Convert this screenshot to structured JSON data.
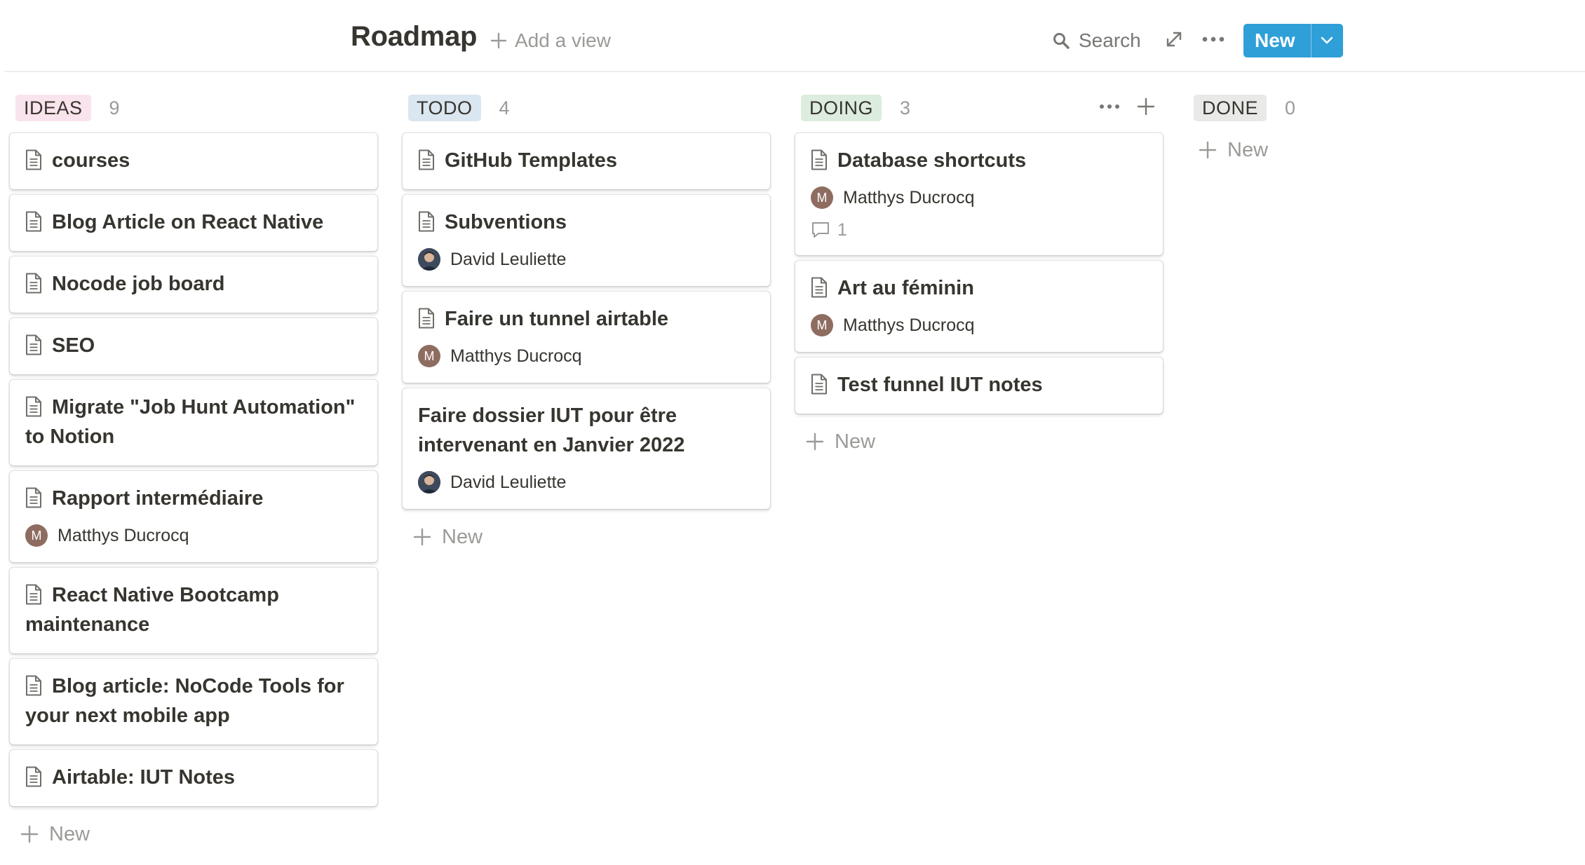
{
  "header": {
    "title": "Roadmap",
    "add_view": "Add a view",
    "search": "Search",
    "new_button": "New"
  },
  "columns": [
    {
      "tag": "IDEAS",
      "count": "9",
      "tag_color": "#f9e3ec",
      "new_label": "New",
      "cards": [
        {
          "title": "courses"
        },
        {
          "title": "Blog Article on React Native"
        },
        {
          "title": "Nocode job board"
        },
        {
          "title": "SEO"
        },
        {
          "title": "Migrate \"Job Hunt Automation\" to Notion"
        },
        {
          "title": "Rapport intermédiaire",
          "person": "Matthys Ducrocq",
          "avatar_initial": "M"
        },
        {
          "title": "React Native Bootcamp maintenance"
        },
        {
          "title": "Blog article: NoCode Tools for your next mobile app"
        },
        {
          "title": "Airtable: IUT Notes"
        }
      ]
    },
    {
      "tag": "TODO",
      "count": "4",
      "tag_color": "#dae6f0",
      "new_label": "New",
      "cards": [
        {
          "title": "GitHub Templates"
        },
        {
          "title": "Subventions",
          "person": "David Leuliette"
        },
        {
          "title": "Faire un tunnel airtable",
          "person": "Matthys Ducrocq",
          "avatar_initial": "M"
        },
        {
          "title": "Faire dossier IUT pour être intervenant en Janvier 2022",
          "person": "David Leuliette"
        }
      ]
    },
    {
      "tag": "DOING",
      "count": "3",
      "tag_color": "#dcecdd",
      "new_label": "New",
      "cards": [
        {
          "title": "Database shortcuts",
          "person": "Matthys Ducrocq",
          "avatar_initial": "M",
          "comments": "1"
        },
        {
          "title": "Art au féminin",
          "person": "Matthys Ducrocq",
          "avatar_initial": "M"
        },
        {
          "title": "Test funnel IUT notes"
        }
      ]
    },
    {
      "tag": "DONE",
      "count": "0",
      "tag_color": "#e9e9e8",
      "new_label": "New",
      "cards": []
    }
  ],
  "icons": {
    "page": "page-icon",
    "plus": "plus-icon",
    "search": "search-icon",
    "expand": "expand-icon",
    "more": "more-icon",
    "chevron": "chevron-down-icon",
    "comment": "comment-icon"
  },
  "colors": {
    "accent": "#2f9fd8",
    "text": "#37352f",
    "muted": "#9b9a97",
    "avatar": "#8e6d60"
  }
}
